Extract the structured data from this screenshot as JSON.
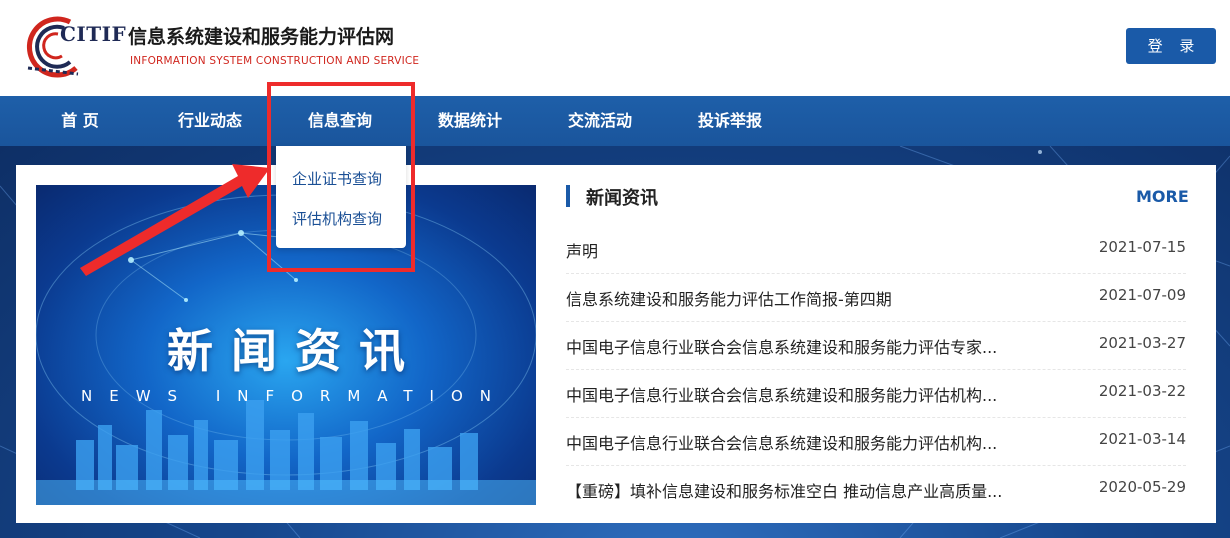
{
  "header": {
    "brand_abbr": "CITIF",
    "brand_cn": "信息系统建设和服务能力评估网",
    "brand_en": "INFORMATION SYSTEM CONSTRUCTION AND SERVICE",
    "login_label": "登 录"
  },
  "nav": {
    "items": [
      {
        "label": "首 页"
      },
      {
        "label": "行业动态"
      },
      {
        "label": "信息查询"
      },
      {
        "label": "数据统计"
      },
      {
        "label": "交流活动"
      },
      {
        "label": "投诉举报"
      }
    ],
    "dropdown": [
      {
        "label": "企业证书查询"
      },
      {
        "label": "评估机构查询"
      }
    ]
  },
  "banner": {
    "title": "新闻资讯",
    "subtitle": "NEWS INFORMATION"
  },
  "news": {
    "title": "新闻资讯",
    "more": "MORE",
    "items": [
      {
        "title": "声明",
        "date": "2021-07-15"
      },
      {
        "title": "信息系统建设和服务能力评估工作简报-第四期",
        "date": "2021-07-09"
      },
      {
        "title": "中国电子信息行业联合会信息系统建设和服务能力评估专家...",
        "date": "2021-03-27"
      },
      {
        "title": "中国电子信息行业联合会信息系统建设和服务能力评估机构...",
        "date": "2021-03-22"
      },
      {
        "title": "中国电子信息行业联合会信息系统建设和服务能力评估机构...",
        "date": "2021-03-14"
      },
      {
        "title": "【重磅】填补信息建设和服务标准空白 推动信息产业高质量...",
        "date": "2020-05-29"
      }
    ]
  },
  "colors": {
    "nav_blue": "#1e5fa9",
    "accent_red": "#ee2b2b",
    "link_blue": "#1a5aa8"
  }
}
